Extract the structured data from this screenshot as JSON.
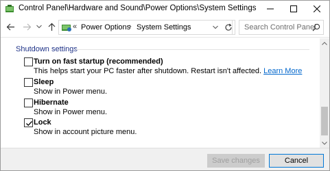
{
  "window": {
    "title": "Control Panel\\Hardware and Sound\\Power Options\\System Settings"
  },
  "address": {
    "prefix": "«",
    "crumbs": [
      "Power Options",
      "System Settings"
    ],
    "separator": "›"
  },
  "search": {
    "placeholder": "Search Control Panel"
  },
  "section": {
    "title": "Shutdown settings"
  },
  "options": [
    {
      "label": "Turn on fast startup (recommended)",
      "description": "This helps start your PC faster after shutdown. Restart isn't affected.",
      "link": "Learn More",
      "checked": false
    },
    {
      "label": "Sleep",
      "description": "Show in Power menu.",
      "checked": false
    },
    {
      "label": "Hibernate",
      "description": "Show in Power menu.",
      "checked": false
    },
    {
      "label": "Lock",
      "description": "Show in account picture menu.",
      "checked": true
    }
  ],
  "footer": {
    "save_label": "Save changes",
    "cancel_label": "Cancel"
  },
  "colors": {
    "section_title": "#1e3287",
    "link": "#0066cc",
    "focus_border": "#0078d7"
  }
}
